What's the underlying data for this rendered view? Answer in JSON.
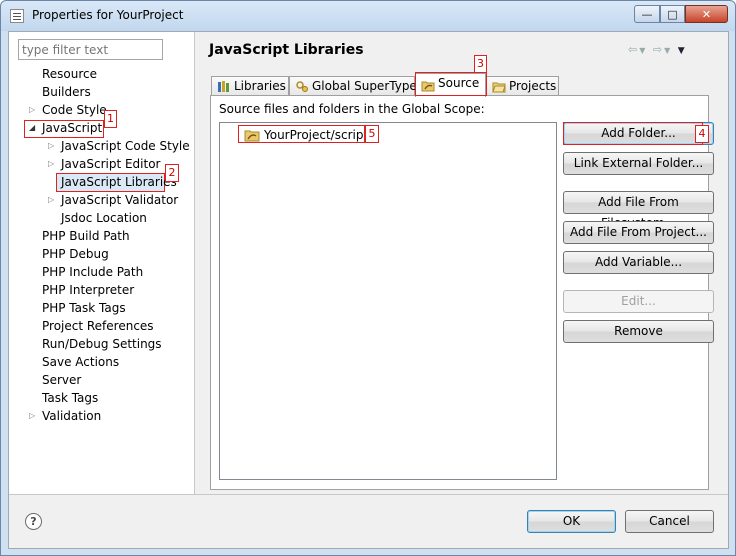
{
  "window": {
    "title": "Properties for YourProject"
  },
  "filter": {
    "placeholder": "type filter text"
  },
  "tree": [
    {
      "label": "Resource"
    },
    {
      "label": "Builders"
    },
    {
      "label": "Code Style"
    },
    {
      "label": "JavaScript"
    },
    {
      "label": "JavaScript Code Style"
    },
    {
      "label": "JavaScript Editor"
    },
    {
      "label": "JavaScript Libraries"
    },
    {
      "label": "JavaScript Validator"
    },
    {
      "label": "Jsdoc Location"
    },
    {
      "label": "PHP Build Path"
    },
    {
      "label": "PHP Debug"
    },
    {
      "label": "PHP Include Path"
    },
    {
      "label": "PHP Interpreter"
    },
    {
      "label": "PHP Task Tags"
    },
    {
      "label": "Project References"
    },
    {
      "label": "Run/Debug Settings"
    },
    {
      "label": "Save Actions"
    },
    {
      "label": "Server"
    },
    {
      "label": "Task Tags"
    },
    {
      "label": "Validation"
    }
  ],
  "page": {
    "title": "JavaScript Libraries"
  },
  "tabs": [
    {
      "label": "Libraries"
    },
    {
      "label": "Global SuperType"
    },
    {
      "label": "Source"
    },
    {
      "label": "Projects"
    }
  ],
  "source": {
    "label": "Source files and folders in the Global Scope:",
    "items": [
      {
        "label": "YourProject/scripts"
      }
    ]
  },
  "buttons": {
    "add_folder": "Add Folder...",
    "link_external": "Link External Folder...",
    "add_file_fs": "Add File From Filesystem...",
    "add_file_project": "Add File From Project...",
    "add_variable": "Add Variable...",
    "edit": "Edit...",
    "remove": "Remove"
  },
  "dialog": {
    "ok": "OK",
    "cancel": "Cancel",
    "help": "?"
  },
  "markers": {
    "m1": "1",
    "m2": "2",
    "m3": "3",
    "m4": "4",
    "m5": "5"
  },
  "colors": {
    "marker": "#dd2222",
    "selection": "#dbe9f6"
  }
}
